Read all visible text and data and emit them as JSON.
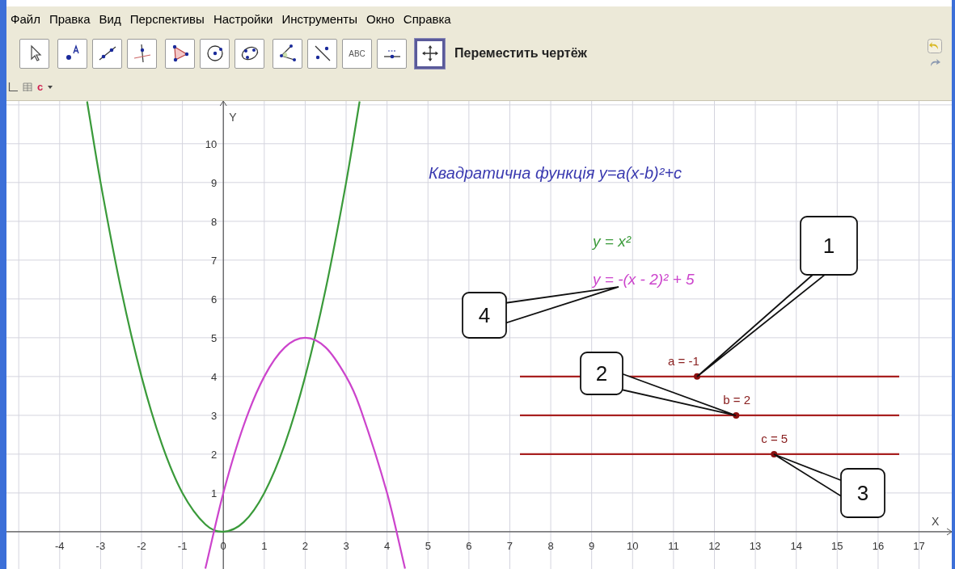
{
  "menu": [
    "Файл",
    "Правка",
    "Вид",
    "Перспективы",
    "Настройки",
    "Инструменты",
    "Окно",
    "Справка"
  ],
  "toolbar": {
    "tools": [
      {
        "kind": "move",
        "selected": false
      },
      {
        "kind": "point",
        "selected": false
      },
      {
        "kind": "line",
        "selected": false
      },
      {
        "kind": "perpendicular",
        "selected": false
      },
      {
        "kind": "polygon",
        "selected": false
      },
      {
        "kind": "circle",
        "selected": false
      },
      {
        "kind": "conic",
        "selected": false
      },
      {
        "kind": "angle",
        "selected": false
      },
      {
        "kind": "reflect",
        "selected": false
      },
      {
        "kind": "text",
        "selected": false,
        "label": "ABC"
      },
      {
        "kind": "slider",
        "selected": false
      },
      {
        "kind": "move-graphics",
        "selected": true
      }
    ],
    "tool_name": "Переместить чертёж"
  },
  "style_bar": {
    "label_style": "c"
  },
  "graphics": {
    "title": "Квадратична функція y=a(x-b)²+c",
    "sliders": [
      {
        "label": "a = -1",
        "level": 0.467
      },
      {
        "label": "b = 2",
        "level": 0.57
      },
      {
        "label": "c = 5",
        "level": 0.67
      }
    ],
    "callouts": [
      "1",
      "2",
      "3",
      "4"
    ],
    "chart_data": {
      "type": "line",
      "xlabel": "X",
      "ylabel": "Y",
      "grid": true,
      "x": [
        -3.33,
        -3,
        -2.5,
        -2,
        -1.5,
        -1,
        -0.44,
        0,
        0.5,
        1,
        1.5,
        2,
        2.5,
        3,
        3.33,
        4,
        4.44
      ],
      "series": [
        {
          "name": "y = x²",
          "color": "#3a9a3a",
          "values": [
            11.09,
            9,
            6.25,
            4,
            2.25,
            1,
            0.19,
            0,
            0.25,
            1,
            2.25,
            4,
            6.25,
            9,
            11.09,
            null,
            null
          ]
        },
        {
          "name": "y = -(x - 2)² + 5",
          "color": "#cc44cc",
          "values": [
            null,
            null,
            null,
            null,
            null,
            null,
            -0.95,
            1,
            2.75,
            4,
            4.75,
            5,
            4.75,
            4,
            3.23,
            1,
            -0.95
          ]
        }
      ],
      "xlim": [
        -5.3,
        17.8
      ],
      "ylim": [
        -0.96,
        11.1
      ],
      "xticks": [
        -4,
        -3,
        -2,
        -1,
        0,
        1,
        2,
        3,
        4,
        5,
        6,
        7,
        8,
        9,
        10,
        11,
        12,
        13,
        14,
        15,
        16,
        17
      ],
      "yticks": [
        1,
        2,
        3,
        4,
        5,
        6,
        7,
        8,
        9,
        10
      ]
    }
  }
}
